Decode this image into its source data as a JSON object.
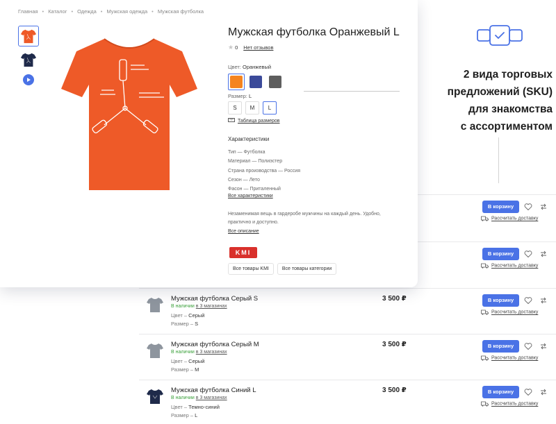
{
  "breadcrumbs": [
    "Главная",
    "Каталог",
    "Одежда",
    "Мужская одежда",
    "Мужская футболка"
  ],
  "product": {
    "title": "Мужская футболка Оранжевый L",
    "rating": "0",
    "reviews_link": "Нет отзывов",
    "color_label": "Цвет:",
    "color_value": "Оранжевый",
    "colors": [
      "#f5841f",
      "#3b4a9a",
      "#5e5e5e"
    ],
    "size_label": "Размер:",
    "size_value": "L",
    "sizes": [
      "S",
      "M",
      "L"
    ],
    "selected_size": "L",
    "size_table_link": "Таблица размеров",
    "characteristics_title": "Характеристики",
    "characteristics": [
      "Тип — Футболка",
      "Материал — Полиэстер",
      "Страна производства — Россия",
      "Сезон — Лето",
      "Фасон — Приталенный"
    ],
    "all_characteristics_link": "Все характеристики",
    "description": "Незаменимая вещь в гардеробе мужчины на каждый день. Удобно, практично и доступно.",
    "all_description_link": "Все описание",
    "brand_logo_text": "KMI",
    "brand_goods_button": "Все товары KMI",
    "category_goods_button": "Все товары категории"
  },
  "annotation": {
    "lines": [
      "2 вида торговых",
      "предложений (SKU)",
      "для знакомства",
      "с ассортиментом"
    ]
  },
  "sku_list": {
    "cart_label": "В корзину",
    "delivery_label": "Рассчитать доставку",
    "color_label": "Цвет –",
    "size_label": "Размер –",
    "in_stock": "В наличии",
    "stores": "в 3 магазинах",
    "rows": [
      {
        "name": "Мужская футболка Серый S",
        "price": "3 500 ₽",
        "color": "Серый",
        "size": "S",
        "tshirt_color": "#8e959e"
      },
      {
        "name": "Мужская футболка Серый M",
        "price": "3 500 ₽",
        "color": "Серый",
        "size": "M",
        "tshirt_color": "#8e959e"
      },
      {
        "name": "Мужская футболка Синий L",
        "price": "3 500 ₽",
        "color": "Темно-синий",
        "size": "L",
        "tshirt_color": "#1f2a4a"
      }
    ]
  }
}
